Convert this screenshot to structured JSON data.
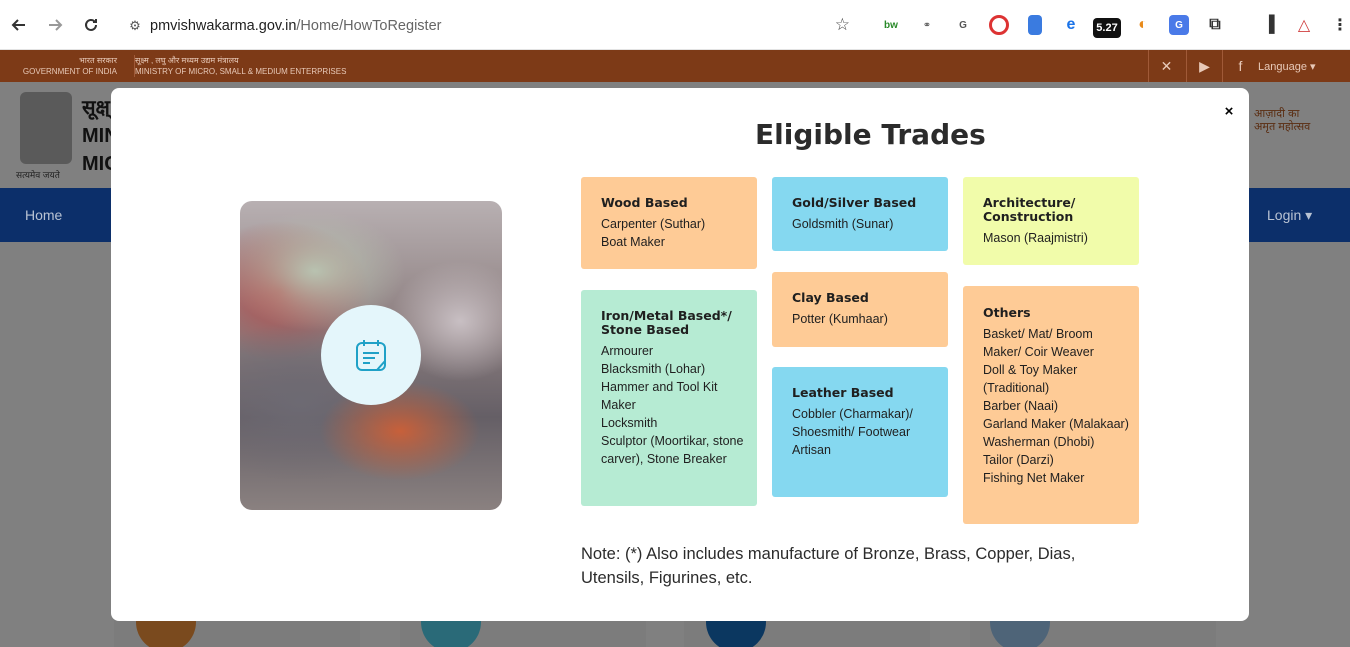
{
  "browser": {
    "back_icon": "arrow-left-icon",
    "forward_icon": "arrow-right-icon",
    "reload_icon": "reload-icon",
    "url_host": "pmvishwakarma.gov.in",
    "url_path": "/Home/HowToRegister",
    "extension_badge": "5.27"
  },
  "site": {
    "gov_hindi": "भारत सरकार",
    "gov_english": "GOVERNMENT OF INDIA",
    "ministry_hindi": "सूक्ष्म , लघु और मध्यम उद्यम मंत्रालय",
    "ministry_english": "MINISTRY OF MICRO, SMALL & MEDIUM ENTERPRISES",
    "language_label": "Language",
    "emblem_caption": "सत्यमेव जयते",
    "title_line1": "सूक्ष्",
    "title_line2": "MIN",
    "title_line3": "MIC",
    "azadi_line1": "आज़ादी का",
    "azadi_line2": "अमृत महोत्सव",
    "nav_home": "Home",
    "nav_login": "Login"
  },
  "modal": {
    "title": "Eligible Trades",
    "close_label": "×",
    "note": "Note: (*) Also includes manufacture of Bronze, Brass, Copper, Dias, Utensils, Figurines, etc.",
    "trades": {
      "wood": {
        "heading": "Wood Based",
        "items": [
          "Carpenter (Suthar)",
          "Boat Maker"
        ]
      },
      "gold": {
        "heading": "Gold/Silver Based",
        "items": [
          "Goldsmith (Sunar)"
        ]
      },
      "architecture": {
        "heading": "Architecture/ Construction",
        "items": [
          "Mason (Raajmistri)"
        ]
      },
      "iron": {
        "heading": "Iron/Metal Based*/ Stone Based",
        "items": [
          "Armourer",
          "Blacksmith (Lohar)",
          "Hammer and Tool Kit Maker",
          "Locksmith",
          "Sculptor (Moortikar, stone carver), Stone Breaker"
        ]
      },
      "clay": {
        "heading": "Clay Based",
        "items": [
          "Potter (Kumhaar)"
        ]
      },
      "leather": {
        "heading": "Leather Based",
        "items": [
          "Cobbler (Charmakar)/ Shoesmith/ Footwear Artisan"
        ]
      },
      "others": {
        "heading": "Others",
        "items": [
          "Basket/ Mat/ Broom Maker/ Coir Weaver",
          "Doll & Toy Maker (Traditional)",
          "Barber (Naai)",
          "Garland Maker (Malakaar)",
          "Washerman (Dhobi)",
          "Tailor (Darzi)",
          "Fishing Net Maker"
        ]
      }
    }
  },
  "colors": {
    "orange": "#fecb96",
    "blue": "#85d8f0",
    "yellow": "#f1fcaa",
    "green": "#b6ebd3",
    "menu_bar": "#0c2f6a",
    "gov_strip": "#7d3a17"
  }
}
